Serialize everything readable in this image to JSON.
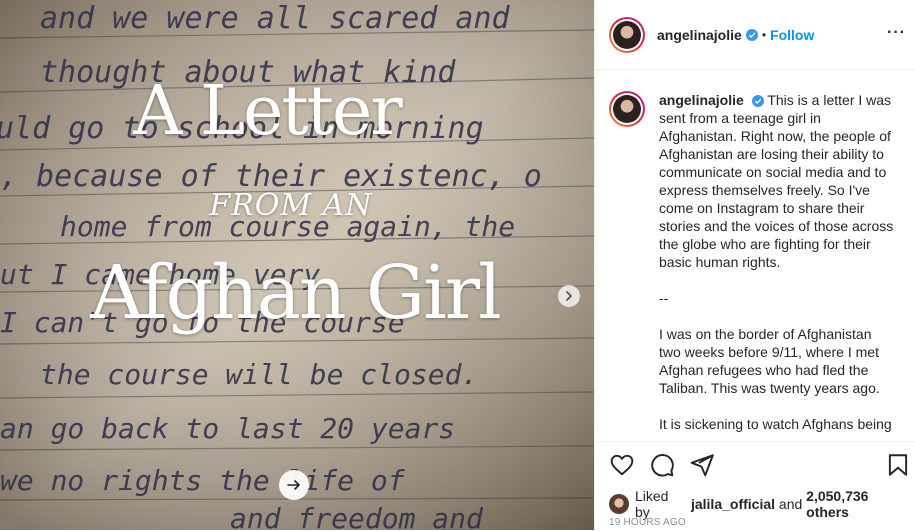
{
  "post": {
    "image_title_line1": "A Letter",
    "image_title_line2": "FROM  AN",
    "image_title_line3": "Afghan Girl",
    "handwriting_lines": [
      "and we were all scared and",
      "thought about what kind",
      "uld go to school in morning",
      ", because of their existenc, o",
      "home from course again, the",
      "ut I came home very",
      "I can't go to the course",
      "the course will be closed.",
      "an go back to last 20 years",
      "we no rights the life of",
      "and freedom and"
    ]
  },
  "header": {
    "username": "angelinajolie",
    "separator": "•",
    "follow_label": "Follow",
    "more_label": "···"
  },
  "caption": {
    "username": "angelinajolie",
    "paragraphs": [
      "This is a letter I was sent from a teenage girl in Afghanistan. Right now, the people of Afghanistan are losing their ability to communicate on social media and to express themselves freely. So I've come on Instagram to share their stories and the voices of those across the globe who are fighting for their basic human rights.",
      "--",
      "I was on the border of Afghanistan two weeks before 9/11, where I met Afghan refugees who had fled the Taliban. This was twenty years ago.",
      "It is sickening to watch Afghans being"
    ]
  },
  "likes": {
    "prefix": "Liked by",
    "user": "jalila_official",
    "connector": "and",
    "others": "2,050,736 others"
  },
  "timestamp": "19 HOURS AGO",
  "colors": {
    "accent": "#0095f6",
    "verified": "#3897f0"
  }
}
